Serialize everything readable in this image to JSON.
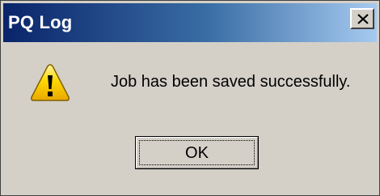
{
  "window": {
    "title": "PQ Log",
    "close_icon": "close-icon"
  },
  "dialog": {
    "icon": "warning-icon",
    "message": "Job has been saved successfully.",
    "ok_label": "OK"
  },
  "colors": {
    "face": "#d4d0c8",
    "title_start": "#0a246a",
    "title_end": "#a6caf0",
    "warning_yellow": "#ffd800"
  }
}
